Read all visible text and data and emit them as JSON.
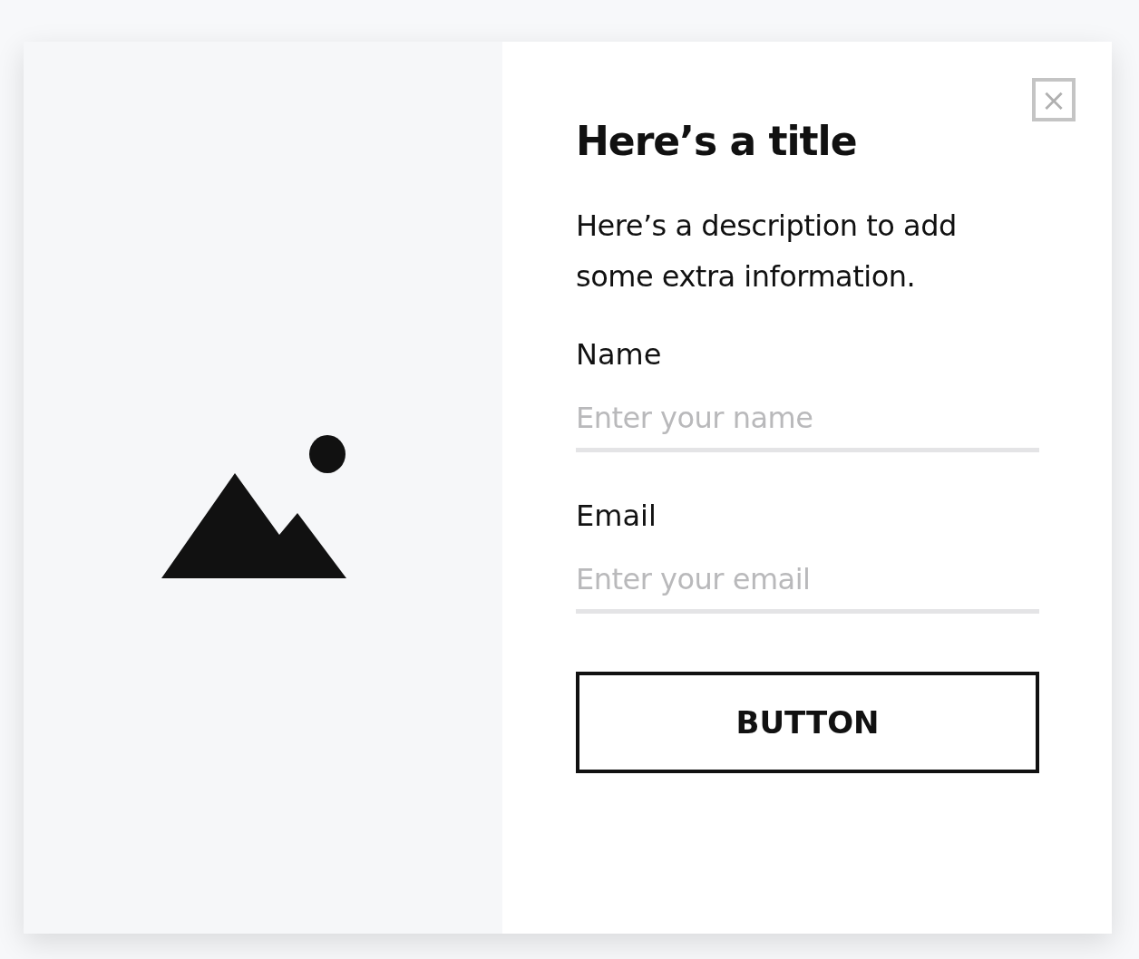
{
  "close_button": {
    "label": "×"
  },
  "title": "Here’s a title",
  "description": "Here’s a description to add some extra information.",
  "fields": [
    {
      "label": "Name",
      "placeholder": "Enter your name"
    },
    {
      "label": "Email",
      "placeholder": "Enter your email"
    }
  ],
  "button": {
    "label": "BUTTON"
  }
}
